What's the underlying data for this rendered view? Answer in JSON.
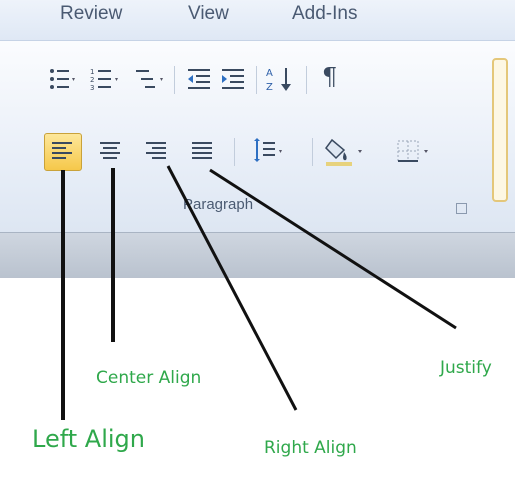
{
  "ribbon": {
    "tabs": [
      {
        "label": "Review"
      },
      {
        "label": "View"
      },
      {
        "label": "Add-Ins"
      }
    ],
    "group_label": "Paragraph"
  },
  "toolbar": {
    "row1": [
      "bullets-icon",
      "numbering-icon",
      "multilevel-list-icon",
      "decrease-indent-icon",
      "increase-indent-icon",
      "sort-icon",
      "pilcrow-icon"
    ],
    "row2": [
      "align-left-icon",
      "align-center-icon",
      "align-right-icon",
      "justify-icon",
      "line-spacing-icon",
      "shading-icon",
      "borders-icon"
    ],
    "selected": "align-left-icon",
    "sort_glyph": "A Z",
    "pilcrow_glyph": "¶"
  },
  "annotations": {
    "left_align": "Left Align",
    "center_align": "Center Align",
    "right_align": "Right Align",
    "justify": "Justify"
  },
  "colors": {
    "annotation_text": "#2fa84b",
    "selected_button": "#f6c84a",
    "pointer_lines": "#111111"
  }
}
